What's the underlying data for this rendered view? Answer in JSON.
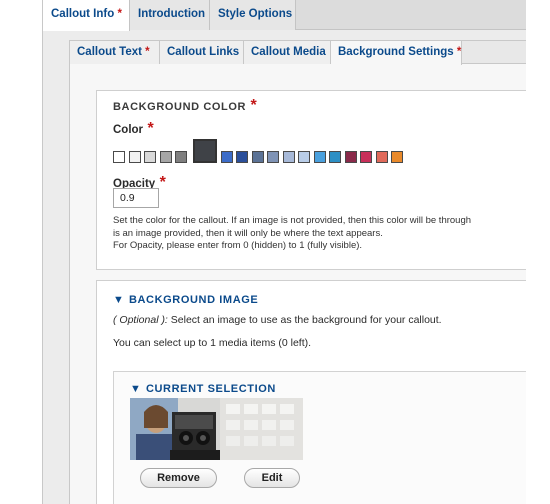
{
  "tabs_top": [
    {
      "label": "Callout Info",
      "required": "*",
      "active": true
    },
    {
      "label": "Introduction",
      "required": "",
      "active": false
    },
    {
      "label": "Style Options",
      "required": "",
      "active": false
    }
  ],
  "tabs_sub": [
    {
      "label": "Callout Text",
      "required": "*"
    },
    {
      "label": "Callout Links",
      "required": ""
    },
    {
      "label": "Callout Media",
      "required": ""
    },
    {
      "label": "Background Settings",
      "required": "*"
    }
  ],
  "background_color": {
    "legend": "BACKGROUND COLOR",
    "required": "*",
    "color_label": "Color",
    "color_required": "*",
    "swatches": [
      "#ffffff",
      "#f2f2f2",
      "#d9d9d9",
      "#a6a6a6",
      "#7f7f7f",
      "#3f4247",
      "#3c6cc8",
      "#2b4f9a",
      "#5c7396",
      "#7f93b5",
      "#a7b9d8",
      "#b9cde8",
      "#4aa0dd",
      "#2d8fc4",
      "#8a2a4a",
      "#c8305a",
      "#e06a5a",
      "#e98a2b"
    ],
    "selected_swatch_index": 5,
    "opacity_label": "Opacity",
    "opacity_required": "*",
    "opacity_value": "0.9",
    "description_lines": [
      "Set the color for the callout. If an image is not provided, then this color will be through",
      "is an image provided, then it will only be where the text appears.",
      "For Opacity, please enter from 0 (hidden) to 1 (fully visible)."
    ]
  },
  "background_image": {
    "legend": "BACKGROUND IMAGE",
    "optional_prefix": "( Optional ):",
    "optional_text": " Select an image to use as the background for your callout.",
    "limit_text": "You can select up to 1 media items (0 left).",
    "current_selection": {
      "legend": "CURRENT SELECTION",
      "remove_label": "Remove",
      "edit_label": "Edit"
    }
  }
}
